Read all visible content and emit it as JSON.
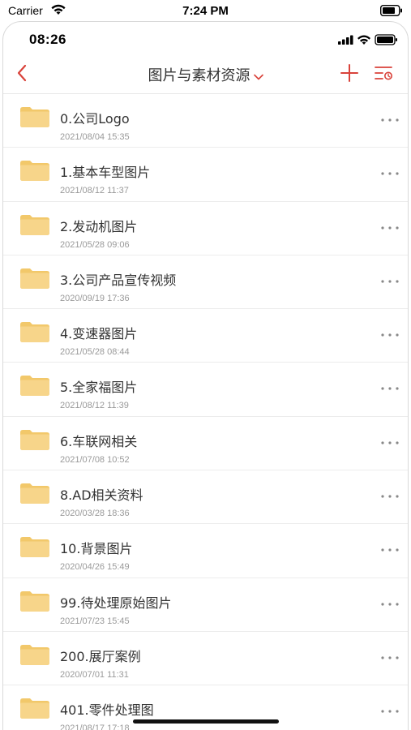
{
  "outer_status": {
    "carrier": "Carrier",
    "time": "7:24 PM"
  },
  "device_status": {
    "time": "08:26"
  },
  "navbar": {
    "title": "图片与素材资源"
  },
  "colors": {
    "accent": "#d9423a",
    "folder": "#f7d58a",
    "folder_tab": "#f2c86a"
  },
  "icons": {
    "back": "chevron-left-icon",
    "title_dropdown": "chevron-down-icon",
    "add": "plus-icon",
    "sort": "sort-filter-icon",
    "folder": "folder-icon",
    "more": "more-icon"
  },
  "folders": [
    {
      "name": "0.公司Logo",
      "date": "2021/08/04 15:35"
    },
    {
      "name": "1.基本车型图片",
      "date": "2021/08/12 11:37"
    },
    {
      "name": "2.发动机图片",
      "date": "2021/05/28 09:06"
    },
    {
      "name": "3.公司产品宣传视频",
      "date": "2020/09/19 17:36"
    },
    {
      "name": "4.变速器图片",
      "date": "2021/05/28 08:44"
    },
    {
      "name": "5.全家福图片",
      "date": "2021/08/12 11:39"
    },
    {
      "name": "6.车联网相关",
      "date": "2021/07/08 10:52"
    },
    {
      "name": "8.AD相关资料",
      "date": "2020/03/28 18:36"
    },
    {
      "name": "10.背景图片",
      "date": "2020/04/26 15:49"
    },
    {
      "name": "99.待处理原始图片",
      "date": "2021/07/23 15:45"
    },
    {
      "name": "200.展厅案例",
      "date": "2020/07/01 11:31"
    },
    {
      "name": "401.零件处理图",
      "date": "2021/08/17 17:18"
    }
  ]
}
